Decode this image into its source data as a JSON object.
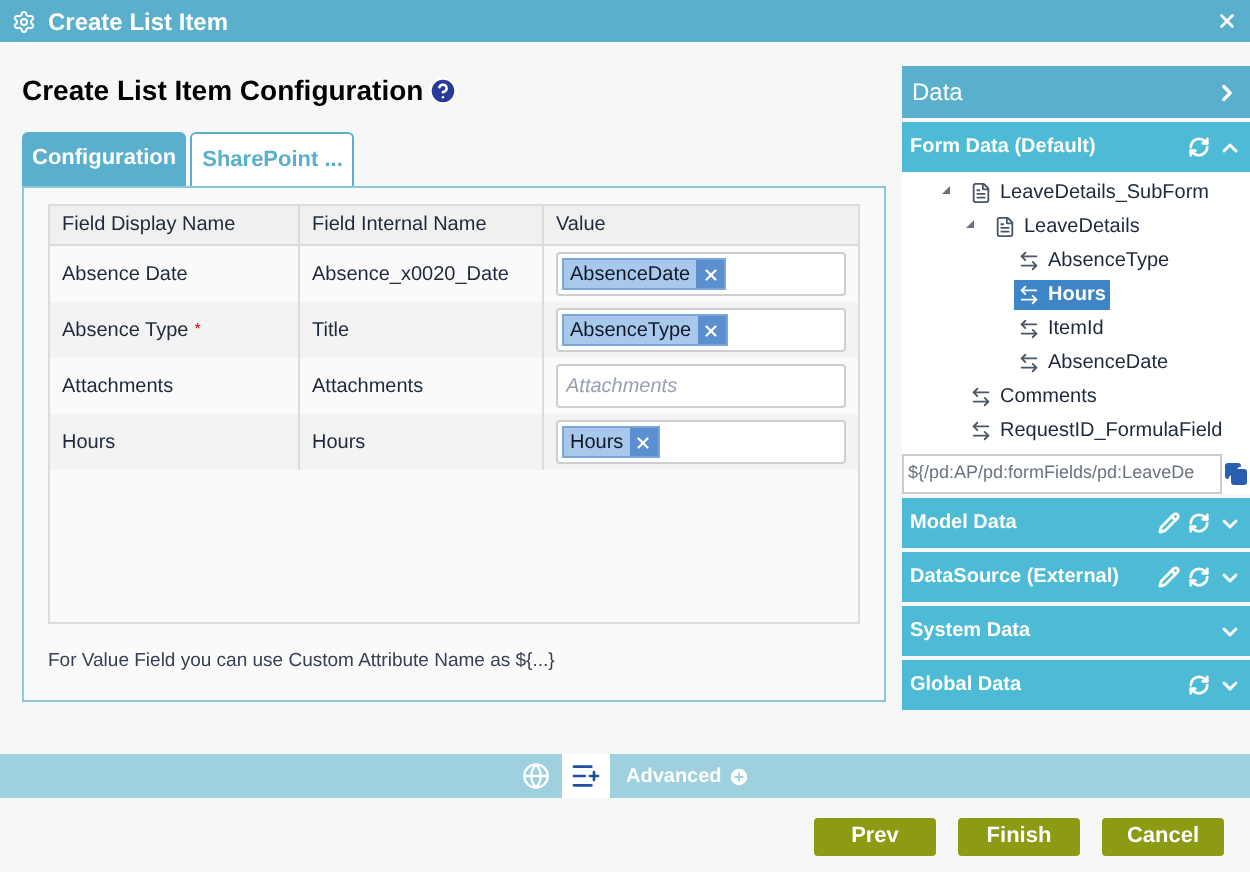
{
  "window": {
    "title": "Create List Item"
  },
  "heading": "Create List Item Configuration",
  "tabs": [
    {
      "label": "Configuration",
      "selected": true
    },
    {
      "label": "SharePoint ...",
      "selected": false
    }
  ],
  "table": {
    "columns": [
      "Field Display Name",
      "Field Internal Name",
      "Value"
    ],
    "rows": [
      {
        "display": "Absence Date",
        "internal": "Absence_x0020_Date",
        "token": "AbsenceDate"
      },
      {
        "display": "Absence Type",
        "required_mark": "*",
        "internal": "Title",
        "token": "AbsenceType"
      },
      {
        "display": "Attachments",
        "internal": "Attachments",
        "placeholder": "Attachments"
      },
      {
        "display": "Hours",
        "internal": "Hours",
        "token": "Hours"
      }
    ]
  },
  "note": "For Value Field you can use Custom Attribute Name as ${...}",
  "toolbar": {
    "advanced": "Advanced"
  },
  "buttons": [
    "Prev",
    "Finish",
    "Cancel"
  ],
  "panel": {
    "title": "Data",
    "sections": [
      {
        "title": "Form Data (Default)",
        "editable": false,
        "refreshable": true,
        "expanded": true,
        "tree": [
          {
            "label": "LeaveDetails_SubForm",
            "kind": "form",
            "expanded": true,
            "selected": false,
            "children": [
              {
                "label": "LeaveDetails",
                "kind": "form",
                "expanded": true,
                "selected": false,
                "children": [
                  {
                    "label": "AbsenceType",
                    "kind": "field",
                    "selected": false
                  },
                  {
                    "label": "Hours",
                    "kind": "field",
                    "selected": true
                  },
                  {
                    "label": "ItemId",
                    "kind": "field",
                    "selected": false
                  },
                  {
                    "label": "AbsenceDate",
                    "kind": "field",
                    "selected": false
                  }
                ]
              }
            ]
          },
          {
            "label": "Comments",
            "kind": "field",
            "selected": false
          },
          {
            "label": "RequestID_FormulaField",
            "kind": "field",
            "selected": false
          }
        ],
        "path": "${/pd:AP/pd:formFields/pd:LeaveDe"
      },
      {
        "title": "Model Data",
        "editable": true,
        "refreshable": true,
        "expanded": false
      },
      {
        "title": "DataSource (External)",
        "editable": true,
        "refreshable": true,
        "expanded": false
      },
      {
        "title": "System Data",
        "editable": false,
        "refreshable": false,
        "expanded": false
      },
      {
        "title": "Global Data",
        "editable": false,
        "refreshable": true,
        "expanded": false
      }
    ]
  }
}
